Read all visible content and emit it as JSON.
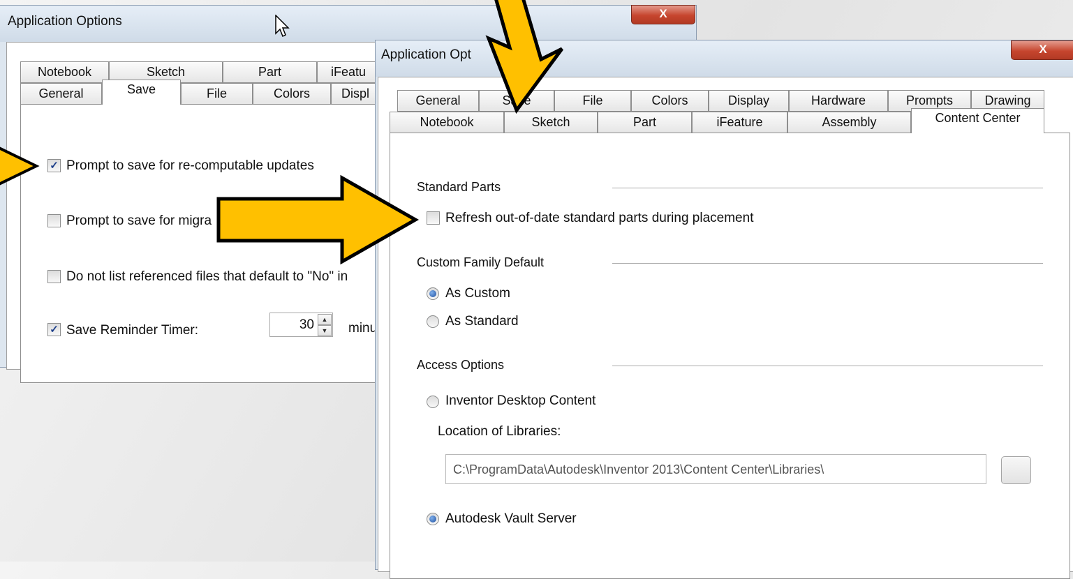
{
  "dialog_back": {
    "title": "Application Options",
    "close_glyph": "X",
    "tabs_row_back": [
      "Notebook",
      "Sketch",
      "Part",
      "iFeatu"
    ],
    "tabs_row_front": [
      "General",
      "Save",
      "File",
      "Colors",
      "Displ"
    ],
    "active_tab": "Save",
    "options": [
      {
        "label": "Prompt to save for re-computable updates",
        "checked": true
      },
      {
        "label": "Prompt to save for migra",
        "checked": false
      },
      {
        "label": "Do not list referenced files that default to \"No\" in",
        "checked": false
      },
      {
        "label": "Save Reminder Timer:",
        "checked": true
      }
    ],
    "timer": {
      "value": "30",
      "unit": "minu"
    }
  },
  "dialog_front": {
    "title": "Application Opt",
    "close_glyph": "X",
    "tabs_row_back": [
      "General",
      "Save",
      "File",
      "Colors",
      "Display",
      "Hardware",
      "Prompts",
      "Drawing"
    ],
    "tabs_row_front": [
      "Notebook",
      "Sketch",
      "Part",
      "iFeature",
      "Assembly",
      "Content Center"
    ],
    "active_tab": "Content Center",
    "standard_parts": {
      "heading": "Standard Parts",
      "refresh_label": "Refresh out-of-date standard parts during placement",
      "refresh_checked": false
    },
    "custom_family": {
      "heading": "Custom Family Default",
      "options": [
        {
          "label": "As Custom",
          "selected": true
        },
        {
          "label": "As Standard",
          "selected": false
        }
      ]
    },
    "access": {
      "heading": "Access Options",
      "desktop_label": "Inventor Desktop Content",
      "desktop_selected": false,
      "location_label": "Location of Libraries:",
      "location_value": "C:\\ProgramData\\Autodesk\\Inventor 2013\\Content Center\\Libraries\\",
      "vault_label": "Autodesk Vault Server",
      "vault_selected": true
    }
  },
  "colors": {
    "arrow_fill": "#ffc000",
    "arrow_outline": "#000000",
    "radio_dot": "#1f4f9e",
    "close_button": "#c6452e"
  },
  "icons": [
    "pointer-cursor-icon",
    "close-x-icon",
    "checkmark-icon",
    "radio-dot-icon",
    "spin-up-icon",
    "spin-down-icon",
    "callout-arrow-icon"
  ]
}
